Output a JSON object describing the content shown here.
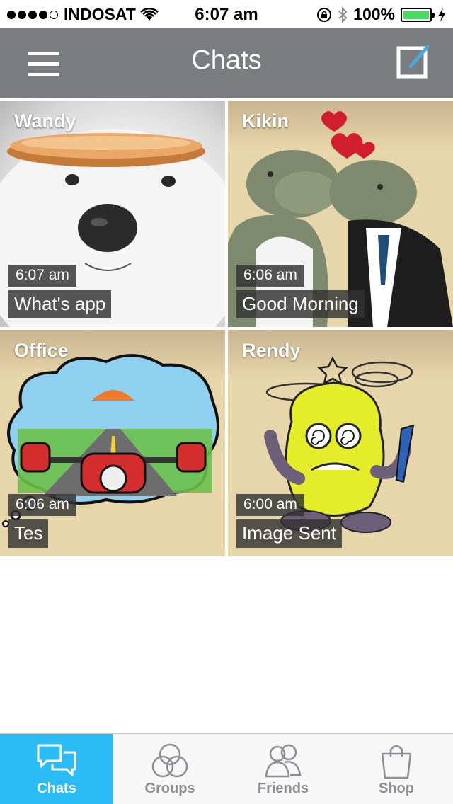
{
  "status_bar": {
    "carrier": "INDOSAT",
    "time": "6:07 am",
    "battery": "100%",
    "battery_level": 1.0
  },
  "header": {
    "title": "Chats",
    "menu_icon": "hamburger-menu-icon",
    "compose_icon": "compose-icon"
  },
  "chats": [
    {
      "name": "Wandy",
      "time": "6:07 am",
      "last_message": "What's app"
    },
    {
      "name": "Kikin",
      "time": "6:06 am",
      "last_message": "Good Morning"
    },
    {
      "name": "Office",
      "time": "6:06 am",
      "last_message": "Tes"
    },
    {
      "name": "Rendy",
      "time": "6:00 am",
      "last_message": "Image Sent"
    }
  ],
  "tabs": [
    {
      "label": "Chats",
      "icon": "chat-bubbles-icon",
      "active": true
    },
    {
      "label": "Groups",
      "icon": "groups-circles-icon",
      "active": false
    },
    {
      "label": "Friends",
      "icon": "friends-icon",
      "active": false
    },
    {
      "label": "Shop",
      "icon": "shopping-bag-icon",
      "active": false
    }
  ],
  "colors": {
    "nav_bg": "#7a7c80",
    "tab_active": "#2bbcf6",
    "battery_fill": "#4cd964",
    "tile_bg": "#e8d6ab"
  }
}
